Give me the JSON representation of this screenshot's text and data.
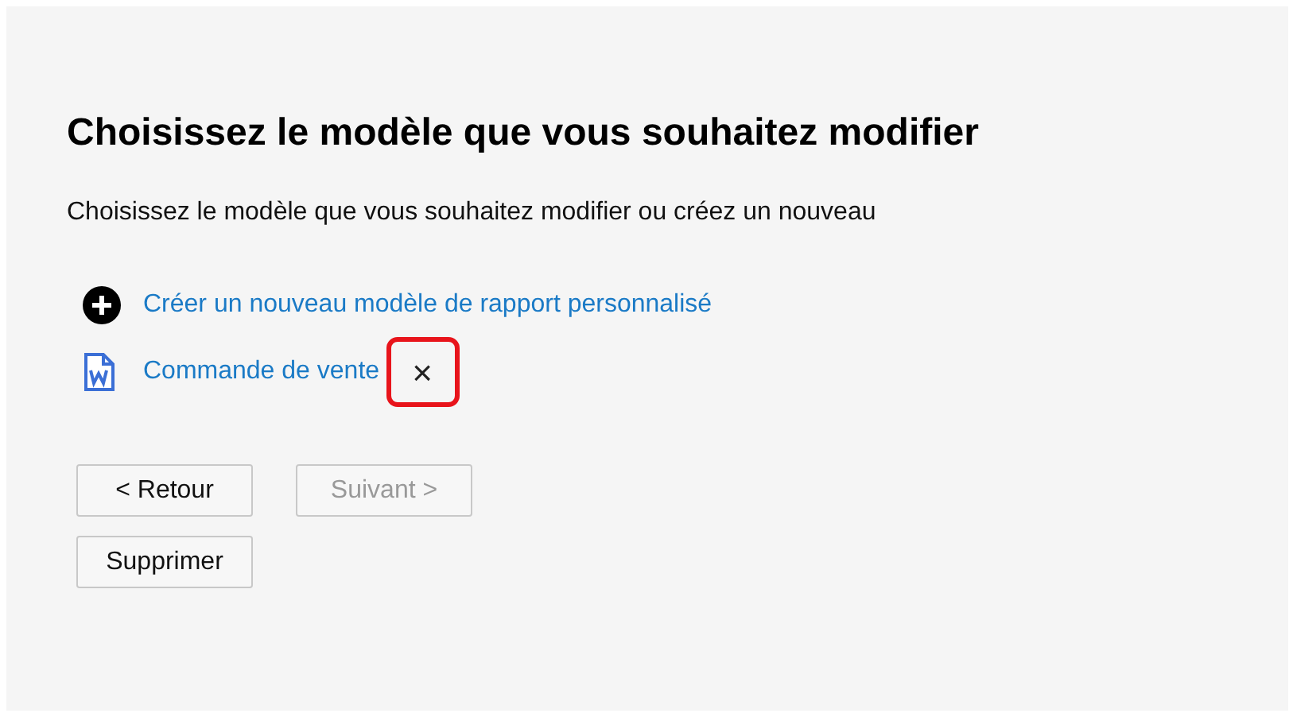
{
  "title": "Choisissez le modèle que vous souhaitez modifier",
  "subtitle": "Choisissez le modèle que vous souhaitez modifier ou créez un nouveau",
  "items": [
    {
      "kind": "add",
      "label": "Créer un nouveau modèle de rapport personnalisé"
    },
    {
      "kind": "template",
      "label": "Commande de vente",
      "delete": {
        "label": "×",
        "highlighted": true
      }
    }
  ],
  "button_rows": [
    [
      {
        "label": "< Retour",
        "disabled": false
      },
      {
        "label": "Suivant >",
        "disabled": true
      }
    ],
    [
      {
        "label": "Supprimer",
        "disabled": false
      }
    ]
  ]
}
